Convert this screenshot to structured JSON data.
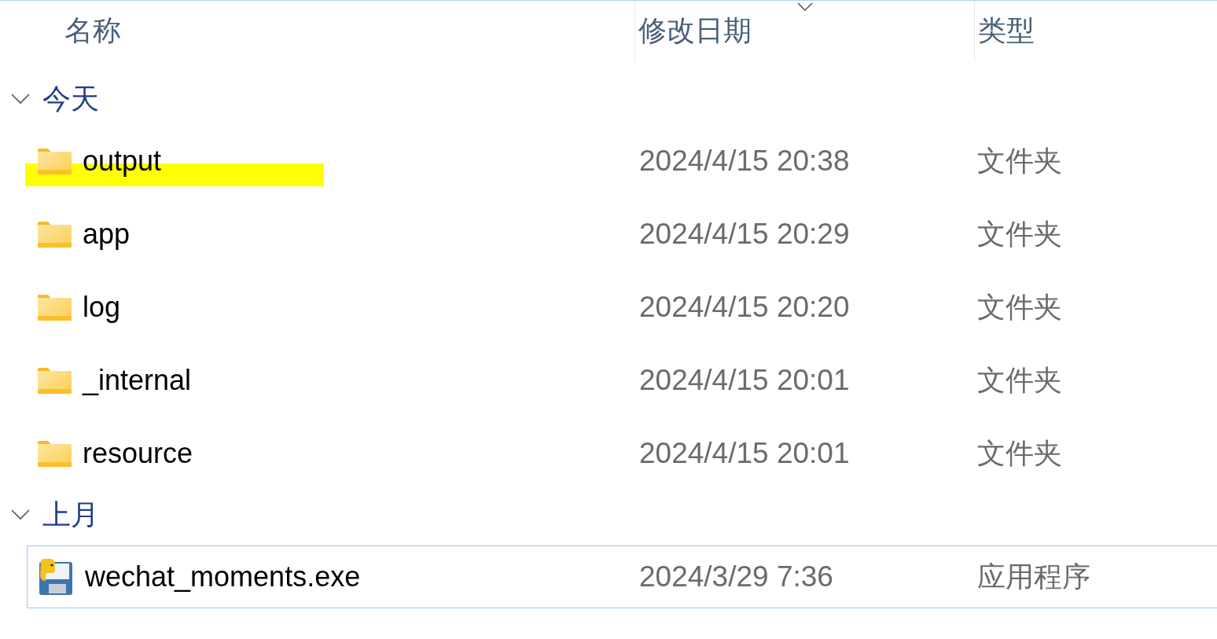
{
  "columns": [
    {
      "label": "名称",
      "sorted": false
    },
    {
      "label": "修改日期",
      "sorted": true
    },
    {
      "label": "类型",
      "sorted": false
    }
  ],
  "groups": [
    {
      "label": "今天",
      "expanded": true,
      "items": [
        {
          "kind": "folder",
          "name": "output",
          "date": "2024/4/15 20:38",
          "type": "文件夹",
          "highlighted": true,
          "focused": false
        },
        {
          "kind": "folder",
          "name": "app",
          "date": "2024/4/15 20:29",
          "type": "文件夹",
          "highlighted": false,
          "focused": false
        },
        {
          "kind": "folder",
          "name": "log",
          "date": "2024/4/15 20:20",
          "type": "文件夹",
          "highlighted": false,
          "focused": false
        },
        {
          "kind": "folder",
          "name": "_internal",
          "date": "2024/4/15 20:01",
          "type": "文件夹",
          "highlighted": false,
          "focused": false
        },
        {
          "kind": "folder",
          "name": "resource",
          "date": "2024/4/15 20:01",
          "type": "文件夹",
          "highlighted": false,
          "focused": false
        }
      ]
    },
    {
      "label": "上月",
      "expanded": true,
      "items": [
        {
          "kind": "program",
          "name": "wechat_moments.exe",
          "date": "2024/3/29 7:36",
          "type": "应用程序",
          "highlighted": false,
          "focused": true
        }
      ]
    }
  ]
}
